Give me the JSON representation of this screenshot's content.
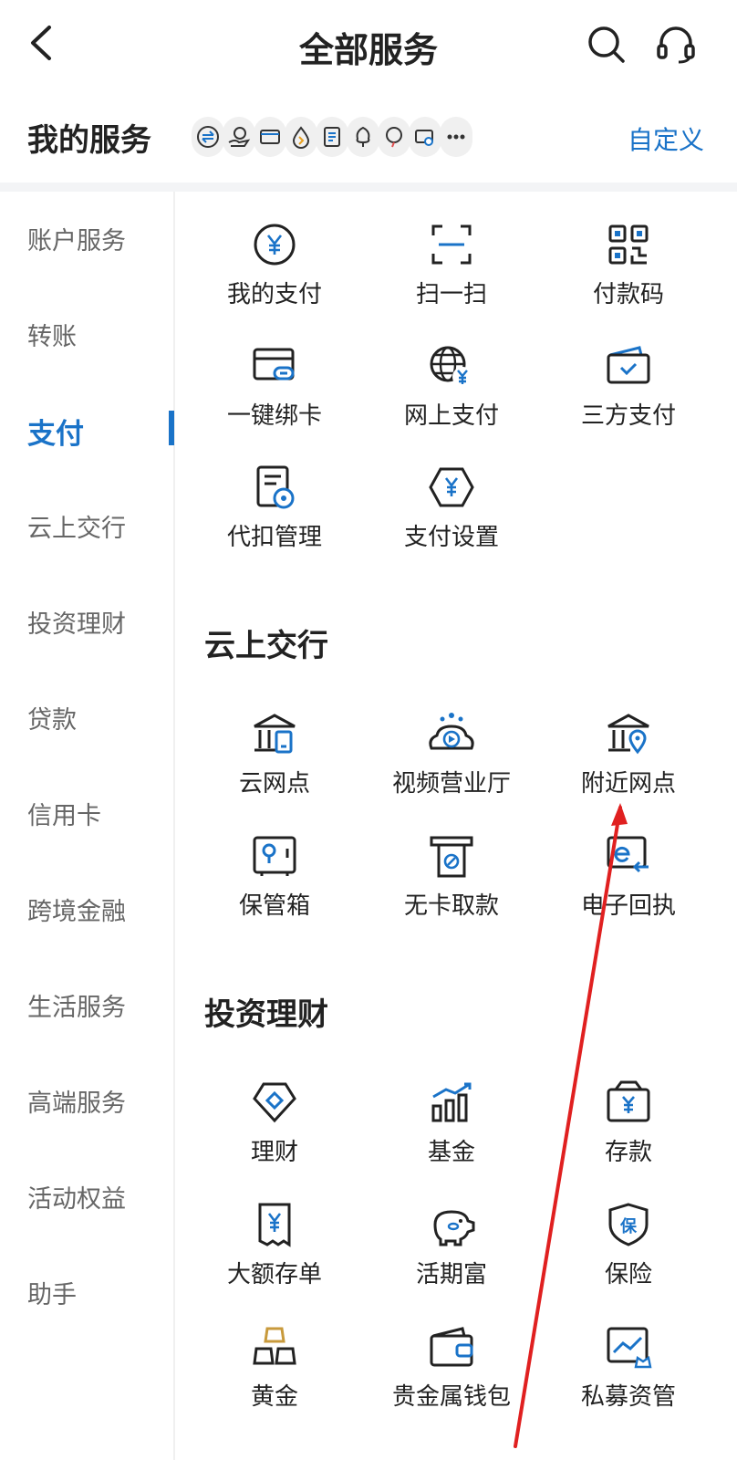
{
  "header": {
    "title": "全部服务",
    "back_icon": "back-chevron-icon",
    "search_icon": "search-icon",
    "service_icon": "headset-icon"
  },
  "my_services": {
    "title": "我的服务",
    "customize_label": "自定义",
    "shortcut_icons": [
      "transfer-icon",
      "hand-money-icon",
      "card-icon",
      "drop-icon",
      "bill-icon",
      "tree-icon",
      "balloon-icon",
      "card-link-icon",
      "more-icon"
    ]
  },
  "sidebar": {
    "items": [
      {
        "label": "账户服务",
        "active": false
      },
      {
        "label": "转账",
        "active": false
      },
      {
        "label": "支付",
        "active": true
      },
      {
        "label": "云上交行",
        "active": false
      },
      {
        "label": "投资理财",
        "active": false
      },
      {
        "label": "贷款",
        "active": false
      },
      {
        "label": "信用卡",
        "active": false
      },
      {
        "label": "跨境金融",
        "active": false
      },
      {
        "label": "生活服务",
        "active": false
      },
      {
        "label": "高端服务",
        "active": false
      },
      {
        "label": "活动权益",
        "active": false
      },
      {
        "label": "助手",
        "active": false
      }
    ]
  },
  "sections": {
    "payment": {
      "items": [
        {
          "label": "我的支付",
          "icon": "yen-circle-icon"
        },
        {
          "label": "扫一扫",
          "icon": "scan-icon"
        },
        {
          "label": "付款码",
          "icon": "qr-code-icon"
        },
        {
          "label": "一键绑卡",
          "icon": "card-bind-icon"
        },
        {
          "label": "网上支付",
          "icon": "globe-yen-icon"
        },
        {
          "label": "三方支付",
          "icon": "wallet-check-icon"
        },
        {
          "label": "代扣管理",
          "icon": "document-gear-icon"
        },
        {
          "label": "支付设置",
          "icon": "hexagon-yen-icon"
        }
      ]
    },
    "cloud_bank": {
      "title": "云上交行",
      "items": [
        {
          "label": "云网点",
          "icon": "bank-phone-icon"
        },
        {
          "label": "视频营业厅",
          "icon": "video-cloud-icon"
        },
        {
          "label": "附近网点",
          "icon": "bank-location-icon"
        },
        {
          "label": "保管箱",
          "icon": "safe-box-icon"
        },
        {
          "label": "无卡取款",
          "icon": "atm-icon"
        },
        {
          "label": "电子回执",
          "icon": "e-receipt-icon"
        }
      ]
    },
    "investment": {
      "title": "投资理财",
      "items": [
        {
          "label": "理财",
          "icon": "diamond-icon"
        },
        {
          "label": "基金",
          "icon": "bar-chart-icon"
        },
        {
          "label": "存款",
          "icon": "deposit-bag-icon"
        },
        {
          "label": "大额存单",
          "icon": "receipt-yen-icon"
        },
        {
          "label": "活期富",
          "icon": "piggy-bank-icon"
        },
        {
          "label": "保险",
          "icon": "shield-insurance-icon"
        },
        {
          "label": "黄金",
          "icon": "gold-bars-icon"
        },
        {
          "label": "贵金属钱包",
          "icon": "wallet-icon"
        },
        {
          "label": "私募资管",
          "icon": "private-fund-icon"
        }
      ]
    }
  },
  "colors": {
    "accent": "#1a73c8",
    "icon_stroke": "#222222",
    "gold": "#c89a3c",
    "annotation_arrow": "#e02020"
  }
}
